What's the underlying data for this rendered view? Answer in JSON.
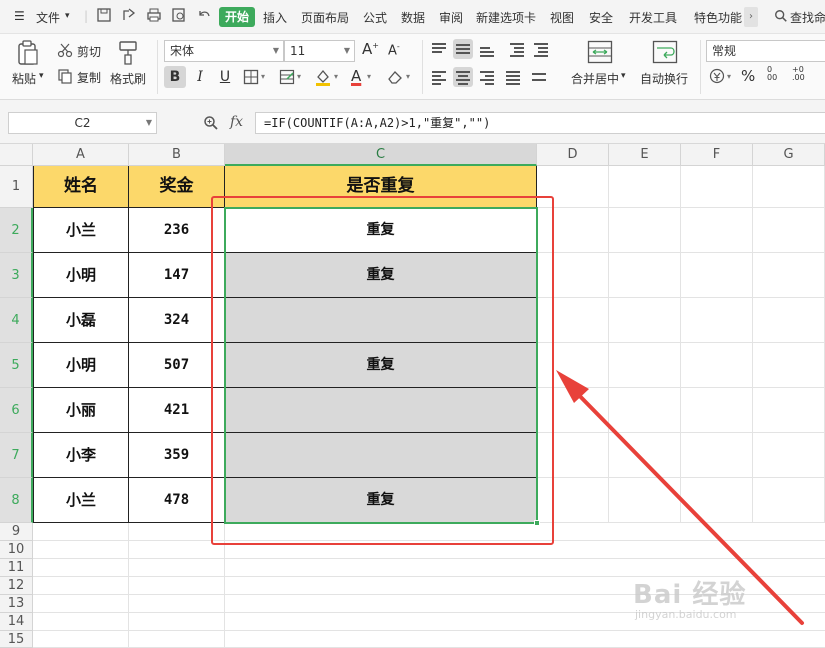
{
  "menubar": {
    "file_label": "文件",
    "tabs": [
      "开始",
      "插入",
      "页面布局",
      "公式",
      "数据",
      "审阅",
      "新建选项卡",
      "视图",
      "安全",
      "开发工具",
      "特色功能"
    ],
    "active_tab": "开始",
    "search_label": "查找命"
  },
  "ribbon": {
    "paste_label": "粘贴",
    "cut_label": "剪切",
    "copy_label": "复制",
    "format_painter_label": "格式刷",
    "font_name": "宋体",
    "font_size": "11",
    "merge_center_label": "合并居中",
    "wrap_text_label": "自动换行",
    "number_format": "常规",
    "percent_symbol": "%"
  },
  "formula_bar": {
    "name_box": "C2",
    "fx_label": "fx",
    "formula": "=IF(COUNTIF(A:A,A2)>1,\"重复\",\"\")"
  },
  "sheet": {
    "columns": [
      "A",
      "B",
      "C",
      "D",
      "E",
      "F",
      "G"
    ],
    "rows": [
      "1",
      "2",
      "3",
      "4",
      "5",
      "6",
      "7",
      "8",
      "9",
      "10",
      "11",
      "12",
      "13",
      "14",
      "15"
    ],
    "headers": [
      "姓名",
      "奖金",
      "是否重复"
    ],
    "data": [
      {
        "name": "小兰",
        "bonus": "236",
        "dup": "重复"
      },
      {
        "name": "小明",
        "bonus": "147",
        "dup": "重复"
      },
      {
        "name": "小磊",
        "bonus": "324",
        "dup": ""
      },
      {
        "name": "小明",
        "bonus": "507",
        "dup": "重复"
      },
      {
        "name": "小丽",
        "bonus": "421",
        "dup": ""
      },
      {
        "name": "小李",
        "bonus": "359",
        "dup": ""
      },
      {
        "name": "小兰",
        "bonus": "478",
        "dup": "重复"
      }
    ]
  },
  "watermark": {
    "brand": "Bai 经验",
    "url": "jingyan.baidu.com"
  },
  "colors": {
    "accent": "#3daa5c",
    "header_fill": "#fcd86a",
    "selection_fill": "#d9d9d9",
    "annotation_red": "#e8413a"
  }
}
